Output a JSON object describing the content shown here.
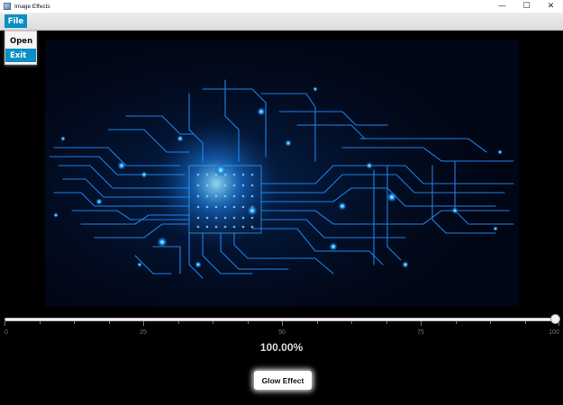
{
  "window": {
    "title": "Image Effects",
    "controls": {
      "minimize_glyph": "—",
      "maximize_glyph": "☐",
      "close_glyph": "✕"
    }
  },
  "menubar": {
    "file_label": "File",
    "file_items": [
      "Open",
      "Exit"
    ],
    "highlighted_item": "Exit"
  },
  "image": {
    "description_icon": "circuit-board-image"
  },
  "slider": {
    "value": 100,
    "min": 0,
    "max": 100,
    "tick_labels": [
      "0",
      "25",
      "50",
      "75",
      "100"
    ]
  },
  "percent_label": "100.00%",
  "glow_button_label": "Glow Effect",
  "colors": {
    "accent": "#0b8fc4",
    "background": "#000000"
  }
}
